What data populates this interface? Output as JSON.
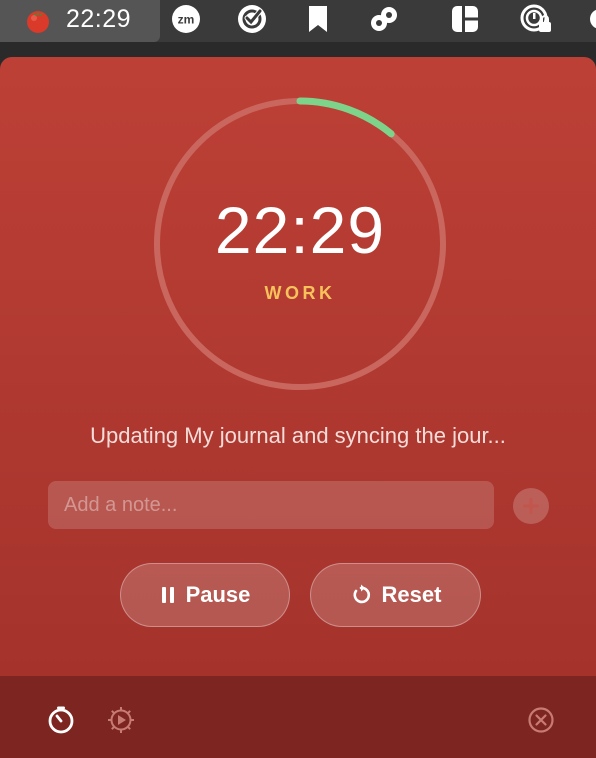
{
  "menubar": {
    "app_icon": "tomato-icon",
    "time": "22:29",
    "status_icons": [
      "zoom-icon",
      "check-circle-icon",
      "bookmark-icon",
      "link-chain-icon",
      "layout-grid-icon",
      "locked-timer-icon"
    ]
  },
  "timer": {
    "time": "22:29",
    "mode": "WORK",
    "progress": 0.11
  },
  "task": {
    "title": "Updating My journal and syncing the jour..."
  },
  "note": {
    "placeholder": "Add a note..."
  },
  "controls": {
    "pause_label": "Pause",
    "reset_label": "Reset"
  },
  "footer": {
    "icons": [
      "timer-icon",
      "settings-gear-icon",
      "close-circle-icon"
    ]
  },
  "colors": {
    "background": "#b83d34",
    "footer": "#7d2621",
    "ring_track": "#c9675f",
    "ring_progress": "#7ed38b",
    "mode_label": "#f7c25c",
    "task_title": "#f5dcd8"
  }
}
